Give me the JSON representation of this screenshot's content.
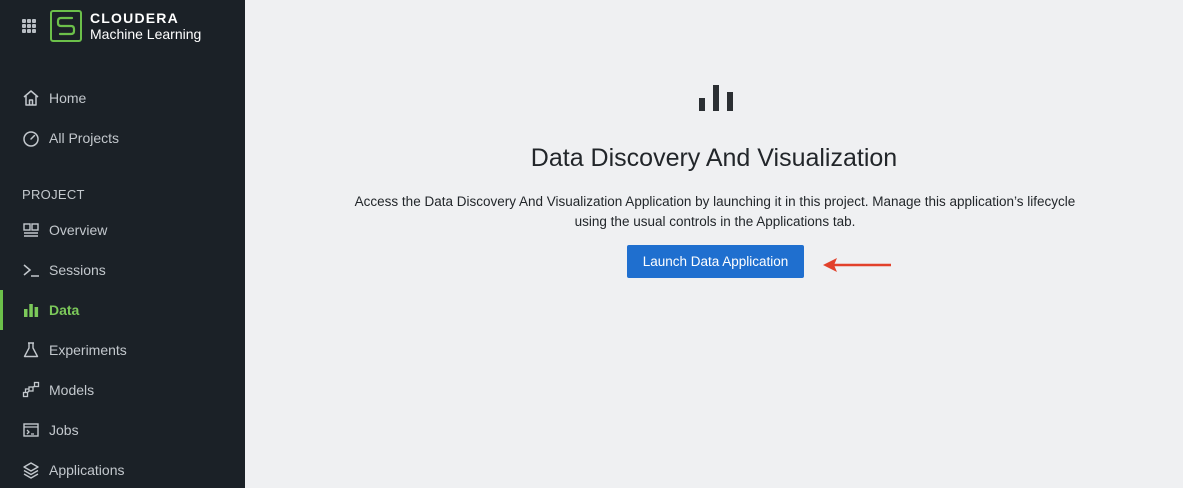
{
  "brand": {
    "name": "CLOUDERA",
    "product": "Machine Learning",
    "accent_color": "#6cc04a"
  },
  "sidebar": {
    "top_items": [
      {
        "label": "Home",
        "icon": "home-icon"
      },
      {
        "label": "All Projects",
        "icon": "gauge-icon"
      }
    ],
    "section_label": "PROJECT",
    "project_items": [
      {
        "label": "Overview",
        "icon": "overview-icon"
      },
      {
        "label": "Sessions",
        "icon": "terminal-icon"
      },
      {
        "label": "Data",
        "icon": "bar-chart-icon",
        "active": true
      },
      {
        "label": "Experiments",
        "icon": "flask-icon"
      },
      {
        "label": "Models",
        "icon": "models-icon"
      },
      {
        "label": "Jobs",
        "icon": "jobs-icon"
      },
      {
        "label": "Applications",
        "icon": "layers-icon"
      }
    ]
  },
  "main": {
    "icon": "bar-chart-icon",
    "title": "Data Discovery And Visualization",
    "description_line1": "Access the Data Discovery And Visualization Application by launching it in this project. Manage this application’s lifecycle",
    "description_line2": "using the usual controls in the Applications tab.",
    "launch_button_label": "Launch Data Application",
    "button_color": "#1f6fcf",
    "annotation_arrow_color": "#e2412b"
  }
}
